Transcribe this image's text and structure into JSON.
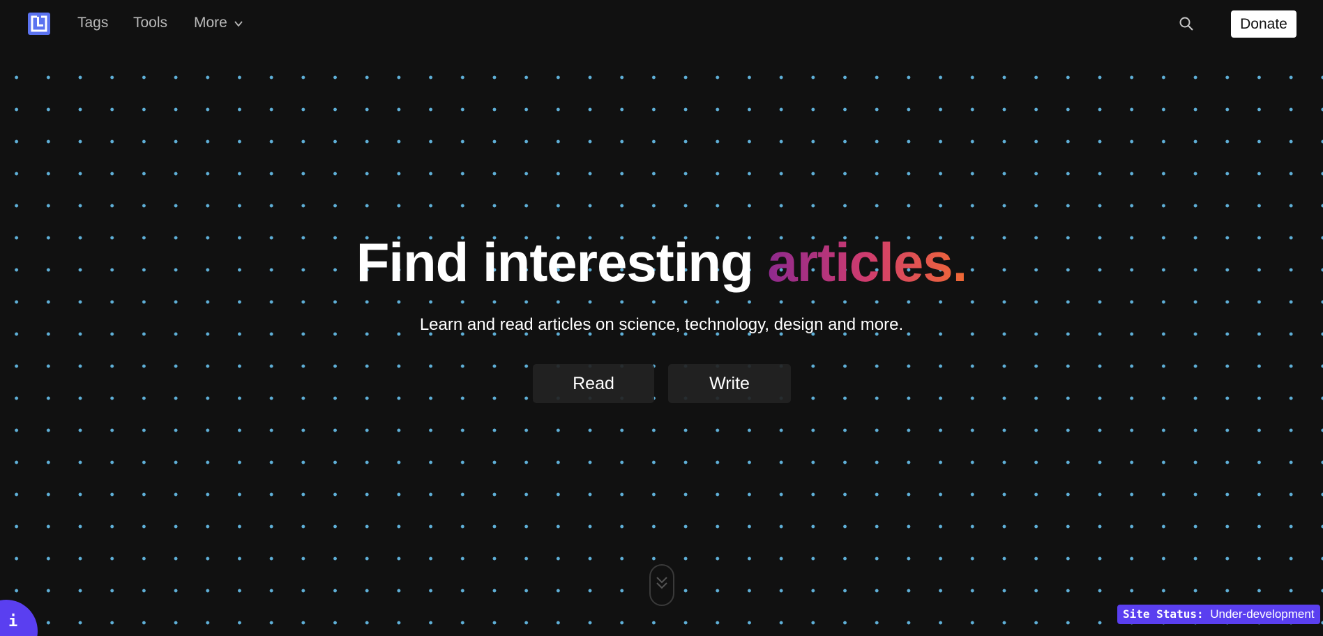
{
  "nav": {
    "logo": "logo-icon",
    "links": [
      "Tags",
      "Tools",
      "More"
    ],
    "search_icon": "search-icon",
    "donate_label": "Donate"
  },
  "hero": {
    "title_prefix": "Find interesting ",
    "title_highlight": "articles.",
    "subtitle": "Learn and read articles on science, technology, design and more.",
    "buttons": [
      "Read",
      "Write"
    ]
  },
  "scroll_indicator": "double-chevron-down-icon",
  "info_button": "i",
  "status": {
    "label": "Site Status:",
    "value": "Under-development"
  },
  "colors": {
    "background": "#111111",
    "dot": "#5fb0d8",
    "accent": "#5a3ff0",
    "logo": "#5b73f0",
    "gradient": [
      "#8e2a8e",
      "#d03c6e",
      "#f06a35"
    ]
  }
}
